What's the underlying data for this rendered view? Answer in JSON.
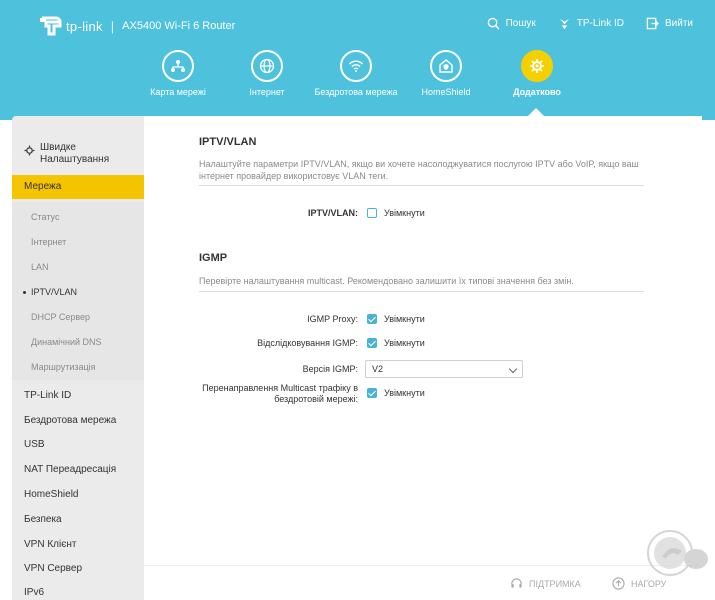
{
  "header": {
    "brand": "tp-link",
    "separator": "|",
    "model": "AX5400 Wi-Fi 6 Router",
    "top_links": [
      {
        "label": "Пошук",
        "icon": "search-icon"
      },
      {
        "label": "TP-Link ID",
        "icon": "user-icon"
      },
      {
        "label": "Вийти",
        "icon": "logout-icon"
      }
    ],
    "nav": [
      {
        "label": "Карта мережі",
        "icon": "network-map-icon"
      },
      {
        "label": "Інтернет",
        "icon": "globe-icon"
      },
      {
        "label": "Бездротова мережа",
        "icon": "wifi-icon"
      },
      {
        "label": "HomeShield",
        "icon": "home-shield-icon"
      },
      {
        "label": "Додатково",
        "icon": "gear-icon",
        "active": true
      }
    ]
  },
  "sidebar": {
    "quick_setup": "Швидке Налаштування",
    "active_section": "Мережа",
    "sub_items": [
      "Статус",
      "Інтернет",
      "LAN",
      "IPTV/VLAN",
      "DHCP Сервер",
      "Динамічний DNS",
      "Маршрутизація"
    ],
    "active_sub": "IPTV/VLAN",
    "items": [
      "TP-Link ID",
      "Бездротова мережа",
      "USB",
      "NAT Переадресація",
      "HomeShield",
      "Безпека",
      "VPN Клієнт",
      "VPN Сервер",
      "IPv6"
    ]
  },
  "iptv": {
    "title": "IPTV/VLAN",
    "description": "Налаштуйте параметри IPTV/VLAN, якщо ви хочете насолоджуватися послугою IPTV або VoIP, якщо ваш інтернет провайдер використовує VLAN теги.",
    "field_label": "IPTV/VLAN:",
    "checkbox_label": "Увімкнути",
    "enabled": false
  },
  "igmp": {
    "title": "IGMP",
    "description": "Перевірте налаштування multicast. Рекомендовано залишити їх типові значення без змін.",
    "proxy_label": "IGMP Proxy:",
    "proxy_checkbox": "Увімкнути",
    "snooping_label": "Відслідковування IGMP:",
    "snooping_checkbox": "Увімкнути",
    "version_label": "Версія IGMP:",
    "version_value": "V2",
    "forward_label_1": "Перенаправлення Multicast трафіку в",
    "forward_label_2": "бездротовій мережі:",
    "forward_checkbox": "Увімкнути"
  },
  "footer": {
    "support": "ПІДТРИМКА",
    "top": "НАГОРУ"
  },
  "colors": {
    "header": "#4ec1dd",
    "accent": "#f5c400",
    "checkbox": "#4ab3cf"
  }
}
